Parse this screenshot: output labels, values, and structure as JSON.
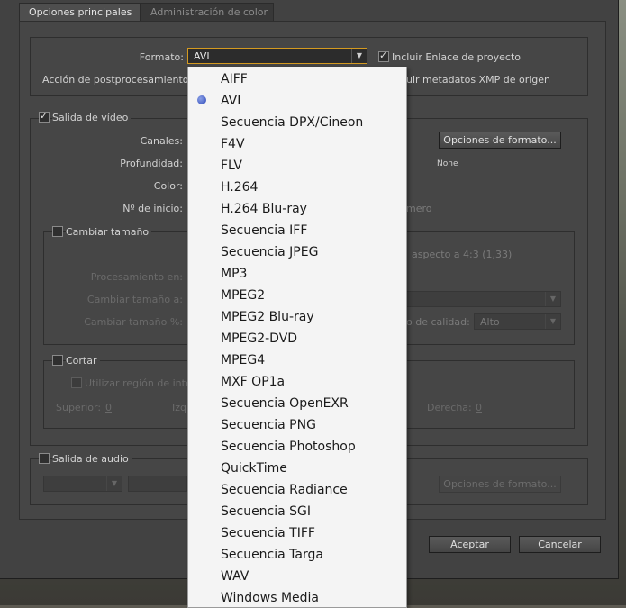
{
  "tabs": [
    "Opciones principales",
    "Administración de color"
  ],
  "format": {
    "label": "Formato:",
    "value": "AVI",
    "include_project_link": "Incluir Enlace de proyecto",
    "postprocess_label": "Acción de postprocesamiento:",
    "xmp_partial": "uir metadatos XMP de origen"
  },
  "video": {
    "section": "Salida de vídeo",
    "channels": "Canales:",
    "depth": "Profundidad:",
    "color": "Color:",
    "start_number": "Nº de inicio:",
    "format_options": "Opciones de formato...",
    "compression": "None",
    "number_partial": "mero"
  },
  "resize": {
    "section": "Cambiar tamaño",
    "aspect_partial": "aspecto a 4:3 (1,33)",
    "processing": "Procesamiento en:",
    "resize_to": "Cambiar tamaño a:",
    "resize_pct": "Cambiar tamaño %:",
    "quality_partial": "o de calidad:",
    "quality_value": "Alto"
  },
  "crop": {
    "section": "Cortar",
    "use_region": "Utilizar región de inter",
    "top": "Superior:",
    "top_val": "0",
    "left_partial": "Izq",
    "right": "Derecha:",
    "right_val": "0"
  },
  "audio": {
    "section": "Salida de audio",
    "format_options": "Opciones de formato..."
  },
  "buttons": {
    "ok": "Aceptar",
    "cancel": "Cancelar"
  },
  "dropdown": {
    "selected_index": 1,
    "items": [
      "AIFF",
      "AVI",
      "Secuencia DPX/Cineon",
      "F4V",
      "FLV",
      "H.264",
      "H.264 Blu-ray",
      "Secuencia IFF",
      "Secuencia JPEG",
      "MP3",
      "MPEG2",
      "MPEG2 Blu-ray",
      "MPEG2-DVD",
      "MPEG4",
      "MXF OP1a",
      "Secuencia OpenEXR",
      "Secuencia PNG",
      "Secuencia Photoshop",
      "QuickTime",
      "Secuencia Radiance",
      "Secuencia SGI",
      "Secuencia TIFF",
      "Secuencia Targa",
      "WAV",
      "Windows Media"
    ]
  }
}
